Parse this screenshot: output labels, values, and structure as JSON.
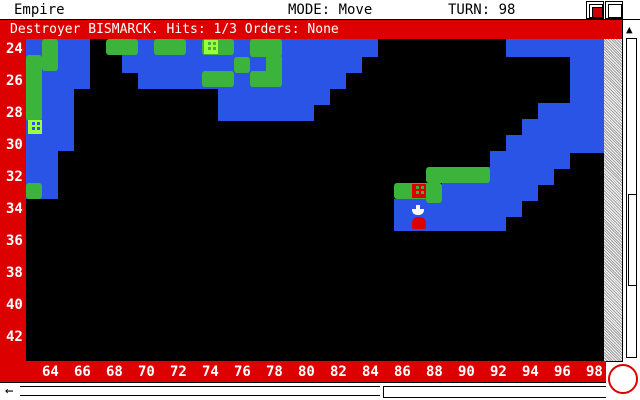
{
  "window": {
    "title": "Empire",
    "mode_text": "MODE: Move",
    "turn_text": "TURN: 98"
  },
  "status": {
    "text": "Destroyer BISMARCK. Hits: 1/3 Orders: None"
  },
  "rows": [
    "24",
    "26",
    "28",
    "30",
    "32",
    "34",
    "36",
    "38",
    "40",
    "42"
  ],
  "cols": [
    "64",
    "66",
    "68",
    "70",
    "72",
    "74",
    "76",
    "78",
    "80",
    "82",
    "84",
    "86",
    "88",
    "90",
    "92",
    "94",
    "96",
    "98"
  ],
  "colors": {
    "water": "#2a54e6",
    "land": "#3cb43c",
    "frame_red": "#d00",
    "own_city": "#9cff3c",
    "enemy_city": "#d00"
  },
  "icons": {
    "scroll_up": "▲",
    "scroll_left": "←"
  }
}
